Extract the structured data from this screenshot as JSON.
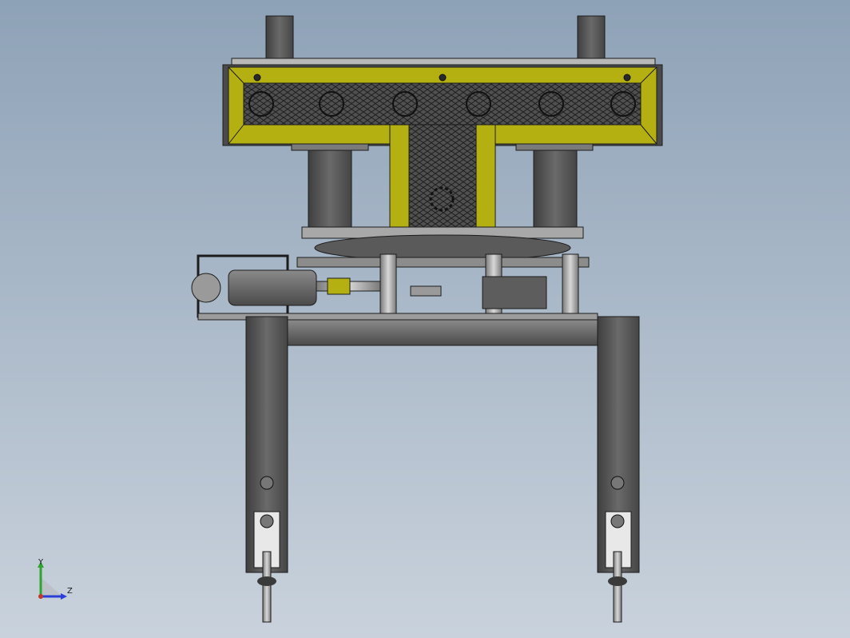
{
  "viewport": {
    "background_top": "#8fa3b8",
    "background_bottom": "#c7d0da"
  },
  "colors": {
    "frame_yellow": "#b5b012",
    "frame_yellow_dark": "#8d8a0e",
    "steel_dark": "#4e4e4e",
    "steel_mid": "#6e6e6e",
    "steel_light": "#a0a0a0",
    "edge": "#1c1c1c",
    "mesh": "#2a2a2a"
  },
  "triad": {
    "y_label": "Y",
    "z_label": "Z",
    "y_color": "#2fa52f",
    "z_color": "#2b3fd8",
    "origin_color": "#c0392b"
  }
}
